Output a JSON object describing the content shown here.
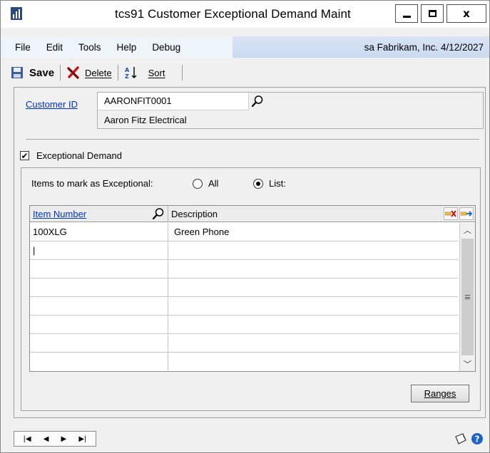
{
  "window": {
    "title": "tcs91 Customer Exceptional Demand Maint",
    "close_glyph": "x"
  },
  "menu": {
    "items": [
      "File",
      "Edit",
      "Tools",
      "Help",
      "Debug"
    ],
    "company_info": "sa  Fabrikam, Inc. 4/12/2027"
  },
  "toolbar": {
    "save_label": "Save",
    "delete_label": "Delete",
    "sort_label": "Sort"
  },
  "customer": {
    "id_label": "Customer ID",
    "id_value": "AARONFIT0001",
    "name_value": "Aaron Fitz Electrical"
  },
  "exceptional": {
    "checkbox_label": "Exceptional Demand",
    "checked": true,
    "items_label": "Items to mark as Exceptional:",
    "radio_all": "All",
    "radio_list": "List:",
    "selected": "List:"
  },
  "grid": {
    "col_item": "Item Number",
    "col_desc": "Description",
    "rows": [
      {
        "item": "100XLG",
        "desc": "Green Phone"
      },
      {
        "item": "|",
        "desc": ""
      },
      {
        "item": "",
        "desc": ""
      },
      {
        "item": "",
        "desc": ""
      },
      {
        "item": "",
        "desc": ""
      },
      {
        "item": "",
        "desc": ""
      },
      {
        "item": "",
        "desc": ""
      },
      {
        "item": "",
        "desc": ""
      }
    ]
  },
  "ranges_button": "Ranges",
  "icons": {
    "lookup": "magnifier-icon",
    "nav": [
      "first-record-icon",
      "previous-record-icon",
      "next-record-icon",
      "last-record-icon"
    ],
    "note": "note-icon",
    "help": "help-icon"
  },
  "colors": {
    "link": "#0033cc",
    "menu_right_bg": "#c9d9f1",
    "delete_x": "#cc1111"
  }
}
